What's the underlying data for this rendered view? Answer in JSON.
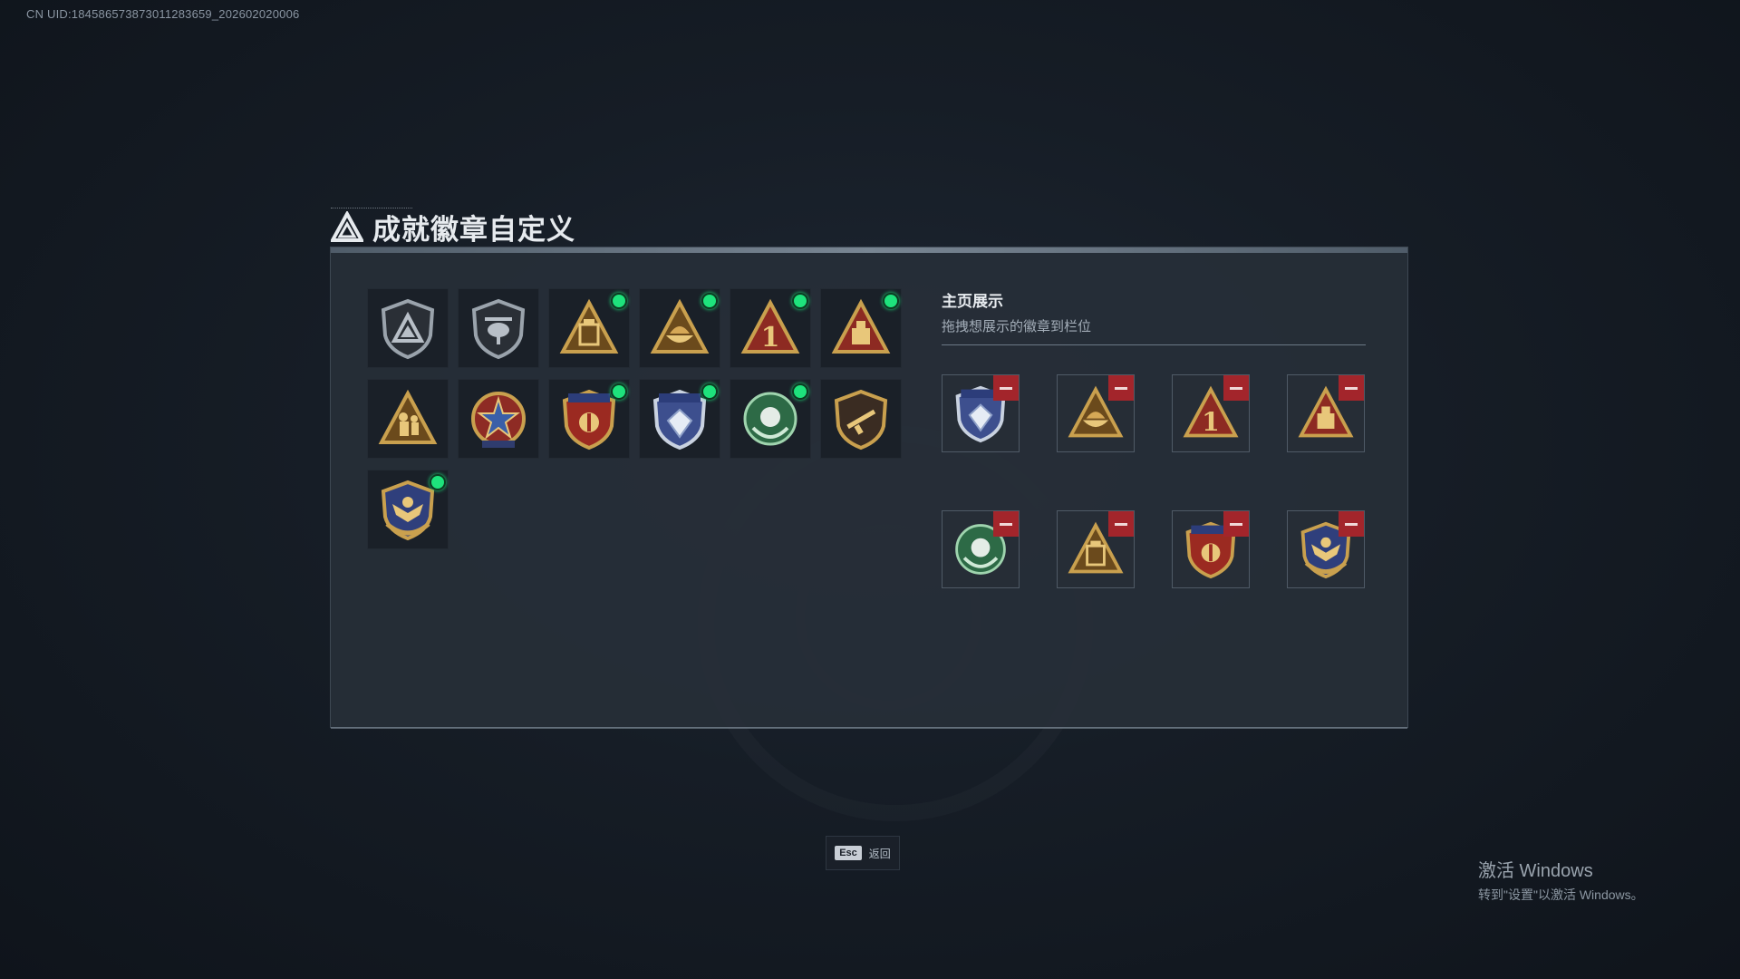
{
  "uid_text": "CN UID:1845865738730112836​59_202602020006",
  "window_title": "成就徽章自定义",
  "badges": [
    {
      "name": "shield-triangle-badge",
      "icon": "shield-triangle",
      "new": false
    },
    {
      "name": "helicopter-shield-badge",
      "icon": "helicopter-shield",
      "new": false
    },
    {
      "name": "gold-triangle-box-badge",
      "icon": "triangle-box",
      "new": true
    },
    {
      "name": "gold-triangle-bowl-badge",
      "icon": "triangle-bowl",
      "new": true
    },
    {
      "name": "red-triangle-one-badge",
      "icon": "triangle-one",
      "new": true
    },
    {
      "name": "red-triangle-crate-badge",
      "icon": "triangle-crate",
      "new": true
    },
    {
      "name": "gold-triangle-soldier-badge",
      "icon": "triangle-soldier",
      "new": false
    },
    {
      "name": "red-star-medal-badge",
      "icon": "star-medal",
      "new": false
    },
    {
      "name": "red-crest-stars-badge",
      "icon": "red-crest",
      "new": true
    },
    {
      "name": "blue-crest-diamond-badge",
      "icon": "blue-crest",
      "new": true
    },
    {
      "name": "green-laurel-badge",
      "icon": "green-laurel",
      "new": true
    },
    {
      "name": "rifle-shield-badge",
      "icon": "rifle-shield",
      "new": false
    },
    {
      "name": "gold-eagle-shield-badge",
      "icon": "eagle-shield",
      "new": true
    }
  ],
  "showcase": {
    "title": "主页展示",
    "subtitle": "拖拽想展示的徽章到栏位",
    "slots": [
      {
        "icon": "blue-crest"
      },
      {
        "icon": "triangle-bowl"
      },
      {
        "icon": "triangle-one"
      },
      {
        "icon": "triangle-crate"
      },
      {
        "icon": "green-laurel"
      },
      {
        "icon": "triangle-box"
      },
      {
        "icon": "red-crest"
      },
      {
        "icon": "eagle-shield"
      }
    ]
  },
  "esc": {
    "key": "Esc",
    "label": "返回"
  },
  "watermark": {
    "title": "激活 Windows",
    "subtitle": "转到\"设置\"以激活 Windows。"
  },
  "colors": {
    "new_dot": "#1ee37c",
    "remove_button": "#a3252b",
    "gold": "#c9a04e",
    "red": "#8d2a22"
  }
}
